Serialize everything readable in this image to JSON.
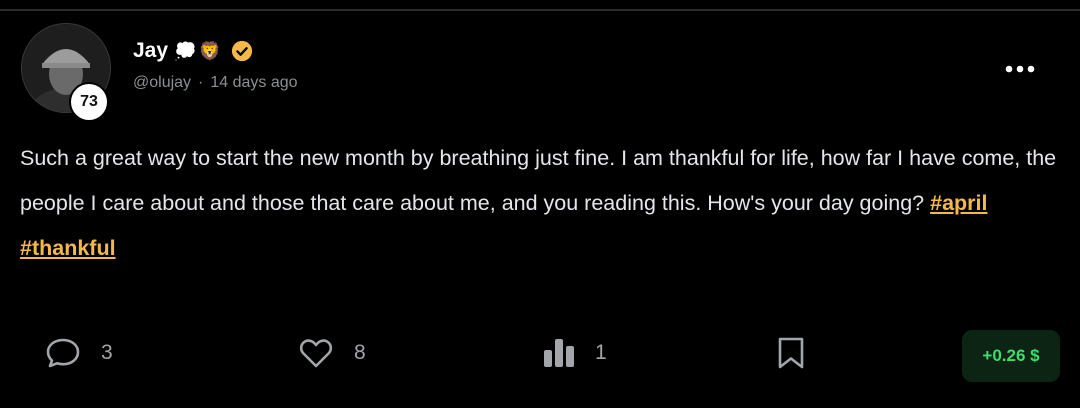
{
  "post": {
    "author": {
      "display_name": "Jay",
      "name_emojis": "💭🦁",
      "handle": "@olujay",
      "level": "73",
      "verified": true
    },
    "time_ago": "14 days ago",
    "meta_separator": "·",
    "body_text": "Such a great way to start the new month by breathing just fine. I am thankful for life, how far I have come, the people I care about and those that care about me, and you reading this. How's your day going?",
    "hashtags": [
      "#april",
      "#thankful"
    ]
  },
  "actions": {
    "comments": "3",
    "likes": "8",
    "views": "1",
    "tip_label": "+0.26 $"
  },
  "icons": {
    "comment": "comment-bubble-icon",
    "like": "heart-icon",
    "views": "bar-chart-icon",
    "bookmark": "bookmark-icon",
    "more": "more-horizontal-icon",
    "verified": "verified-badge-icon"
  },
  "colors": {
    "background": "#000000",
    "hashtag": "#f5b949",
    "verified_badge": "#f5b949",
    "tip_text": "#3ddc6b",
    "tip_background": "#0c2414",
    "muted_text": "#8b8e93"
  }
}
